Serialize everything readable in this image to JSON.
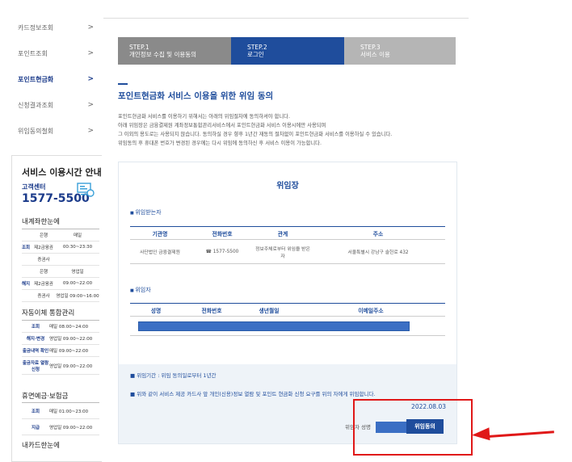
{
  "sidebar": {
    "items": [
      {
        "label": "카드정보조회"
      },
      {
        "label": "포인트조회"
      },
      {
        "label": "포인트현금화"
      },
      {
        "label": "신청결과조회"
      },
      {
        "label": "위임동의철회"
      }
    ],
    "chevron": ">",
    "service": {
      "title": "서비스 이용시간 안내",
      "callcenter": "고객센터",
      "phone": "1577-5500",
      "section1": "내계좌한눈에",
      "rows1": [
        {
          "g": "",
          "a": "은행",
          "b": "매일"
        },
        {
          "g": "조회",
          "a": "제2금융권",
          "b": "00:30~23:30"
        },
        {
          "g": "",
          "a": "증권사",
          "b": ""
        },
        {
          "g": "",
          "a": "은행",
          "b": "영업일"
        },
        {
          "g": "해지",
          "a": "제2금융권",
          "b": "09:00~22:00"
        },
        {
          "g": "",
          "a": "증권사",
          "b": "영업일 09:00~16:00"
        }
      ],
      "section2": "자동이체 통합관리",
      "rows2": [
        {
          "a": "조회",
          "b": "매일 08:00~24:00"
        },
        {
          "a": "해지·변경",
          "b": "영업일 09:00~22:00"
        },
        {
          "a": "출금내역 확인",
          "b": "매일 09:00~22:00"
        },
        {
          "a": "출금자료 열람신청",
          "b": "영업일 09:00~22:00"
        }
      ],
      "section3": "휴면예금·보험금",
      "rows3": [
        {
          "a": "조회",
          "b": "매일 01:00~23:00"
        },
        {
          "a": "지급",
          "b": "영업일 09:00~22:00"
        }
      ],
      "section4": "내카드한눈에"
    }
  },
  "steps": [
    {
      "num": "STEP.1",
      "label": "개인정보 수집 및 이용동의"
    },
    {
      "num": "STEP.2",
      "label": "로그인"
    },
    {
      "num": "STEP.3",
      "label": "서비스 이용"
    }
  ],
  "page_title": "포인트현금화 서비스 이용을 위한 위임 동의",
  "description": [
    "포인트현금화 서비스를 이용하기 위해서는 아래의 위임절차에 동의하셔야 합니다.",
    "아래 위임장은 금융결제원 계좌정보통합관리서비스에서 포인트현금화 서비스 이용시에만 사용되며",
    "그 이외의 용도로는 사용되지 않습니다. 동의하실 경우 향후 1년간 재동의 절차없이 포인트현금화 서비스를 이용하실 수 있습니다.",
    "위임동의 후 휴대폰 번호가 변경된 경우에는 다시 위임에 동의하신 후 서비스 이용이 가능합니다."
  ],
  "mandate": {
    "title": "위임장",
    "receiver_label": "위임받는자",
    "receiver_headers": [
      "기관명",
      "전화번호",
      "관계",
      "주소"
    ],
    "receiver_row": {
      "org": "사단법인 금융결제원",
      "phone": "☎ 1577-5500",
      "relation": "정보주체로부터 위임을 받은자",
      "address": "서울특별시 강남구 솔헌로 432"
    },
    "giver_label": "위임자",
    "giver_headers": [
      "성명",
      "전화번호",
      "생년월일",
      "이메일주소"
    ],
    "period": "위임기간 : 위임 동의일로부터 1년간",
    "consent": "위와 같이 서비스 제공 카드사 앞 개인(신용)정보 열람 및 포인트 현금화 신청 요구를 위의 자에게 위임합니다.",
    "date": "2022.08.03",
    "signer_label": "위임자 성명",
    "agree_button": "위임동의"
  },
  "colors": {
    "accent": "#1f4d9c",
    "highlight": "#e01818"
  }
}
